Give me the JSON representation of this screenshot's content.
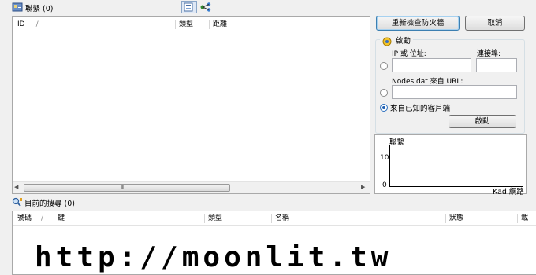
{
  "contacts_panel": {
    "title": "聯繫 (0)",
    "columns": [
      "ID",
      "類型",
      "距離"
    ],
    "sort_arrow": "/",
    "scroll_center": "III"
  },
  "buttons": {
    "recheck_firewall": "重新檢查防火牆",
    "cancel": "取消"
  },
  "bootstrap": {
    "group_title": "啟動",
    "ip_label": "IP 或 位址:",
    "port_label": "連接埠:",
    "nodes_label": "Nodes.dat 來自 URL:",
    "known_clients_label": "來自已知的客戶端",
    "start_button": "啟動",
    "selected": "known_clients"
  },
  "graph": {
    "y_label": "聯繫",
    "y_max": "10",
    "y_min": "0",
    "x_label": "Kad 網路"
  },
  "searches_panel": {
    "title": "目前的搜尋 (0)",
    "columns": [
      "號碼",
      "鍵",
      "類型",
      "名稱",
      "狀態",
      "載"
    ],
    "sort_arrow": "/"
  },
  "watermark": "http://moonlit.tw",
  "icons": [
    "contacts-icon",
    "kad-graph-icon",
    "kad-network-icon",
    "bootstrap-icon",
    "search-icon"
  ]
}
